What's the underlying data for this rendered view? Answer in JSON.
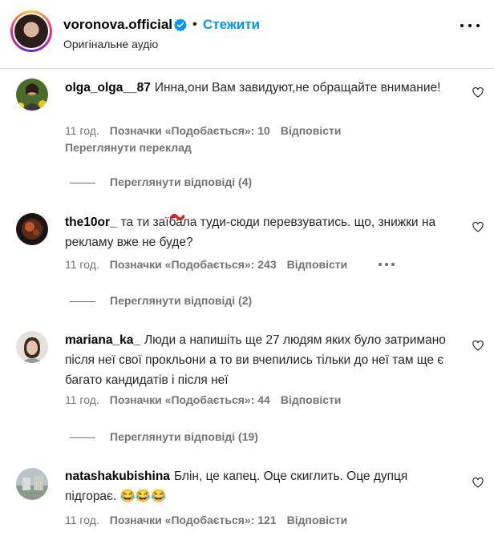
{
  "post": {
    "username": "voronova.official",
    "separator": "•",
    "follow_label": "Стежити",
    "audio_label": "Оригінальне аудіо"
  },
  "comments": [
    {
      "username": "olga_olga__87",
      "text": "Инна,они Вам завидуют,не обращайте внимание!",
      "time": "11 год.",
      "likes": "Позначки «Подобається»: 10",
      "reply_label": "Відповісти",
      "translate_label": "Переглянути переклад",
      "view_replies": "Переглянути відповіді (4)"
    },
    {
      "username": "the10or_",
      "text": "та ти заїбала туди-сюди перевзуватись. що, знижки на рекламу вже не буде?",
      "time": "11 год.",
      "likes": "Позначки «Подобається»: 243",
      "reply_label": "Відповісти",
      "view_replies": "Переглянути відповіді (2)"
    },
    {
      "username": "mariana_ka_",
      "text": "Люди а напишіть ще 27 людям яких було затримано після неї свої прокльони а то ви вчепились тільки до неї там ще є багато кандидатів і після неї",
      "time": "11 год.",
      "likes": "Позначки «Подобається»: 44",
      "reply_label": "Відповісти",
      "view_replies": "Переглянути відповіді (19)"
    },
    {
      "username": "natashakubishina",
      "text": "Блін, це капец. Оце скиглить. Оце дупця підгорає. 😂😂😂",
      "time": "11 год.",
      "likes": "Позначки «Подобається»: 121",
      "reply_label": "Відповісти"
    }
  ],
  "colors": {
    "accent": "#0095f6",
    "secondary_text": "#737373",
    "divider": "#dbdbdb"
  }
}
